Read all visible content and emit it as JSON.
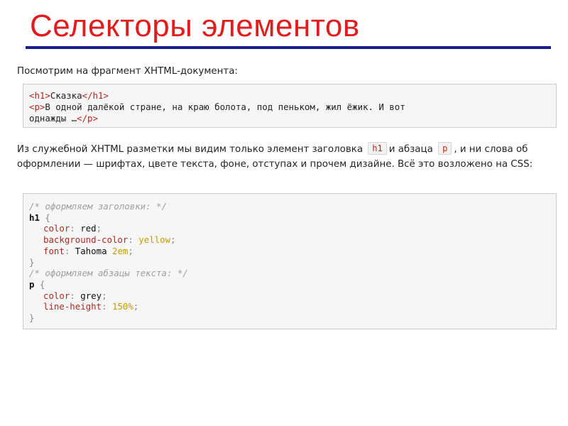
{
  "title": "Селекторы элементов",
  "intro": "Посмотрим на фрагмент XHTML-документа:",
  "html_snippet": {
    "line1": {
      "open_h1": "<h1>",
      "h1_text": "Сказка",
      "close_h1": "</h1>"
    },
    "line2": {
      "open_p": "<p>",
      "p_text": "В одной далёкой стране, на краю болота, под пеньком, жил ёжик. И вот",
      "p_text_cont": "однажды …",
      "close_p": "</p>"
    }
  },
  "explanation": {
    "part1": "Из служебной XHTML разметки мы видим только элемент заголовка",
    "code_h1": "h1",
    "part2": "и абзаца",
    "code_p": "p",
    "part3": ", и ни слова об оформлении — шрифтах, цвете текста, фоне, отступах и прочем дизайне. Всё это возложено на CSS:"
  },
  "css_snippet": {
    "comment1": "/* оформляем заголовки: */",
    "rule1": {
      "selector": "h1",
      "open": "{",
      "decl1": {
        "prop": "color",
        "value": "red"
      },
      "decl2": {
        "prop": "background-color",
        "value": "yellow"
      },
      "decl3": {
        "prop": "font",
        "value_a": "Tahoma",
        "value_b": "2em"
      },
      "close": "}"
    },
    "comment2": "/* оформляем абзацы текста: */",
    "rule2": {
      "selector": "p",
      "open": "{",
      "decl1": {
        "prop": "color",
        "value": "grey"
      },
      "decl2": {
        "prop": "line-height",
        "value": "150%"
      },
      "close": "}"
    }
  },
  "punct": {
    "colon": ":",
    "semicolon": ";",
    "space": " "
  },
  "colors": {
    "title": "#e21c1c",
    "rule": "#1b1f8a",
    "tag": "#b0281f",
    "comment": "#a0a0a0",
    "value": "#c99a00"
  }
}
